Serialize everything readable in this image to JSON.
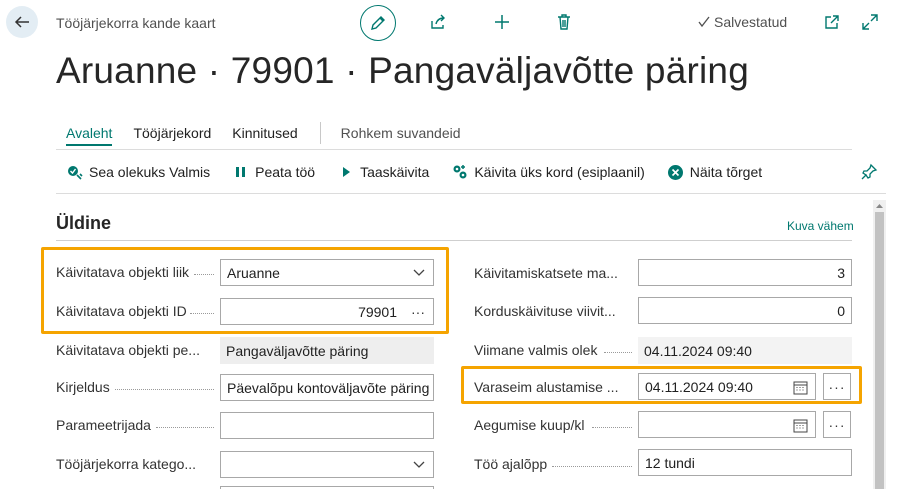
{
  "header": {
    "page_caption": "Tööjärjekorra kande kaart",
    "saved_status": "Salvestatud",
    "title": "Aruanne · 79901 · Pangaväljavõtte päring"
  },
  "tabs": [
    {
      "label": "Avaleht",
      "active": true
    },
    {
      "label": "Tööjärjekord",
      "active": false
    },
    {
      "label": "Kinnitused",
      "active": false
    }
  ],
  "more_options": "Rohkem suvandeid",
  "actions": [
    {
      "label": "Sea olekuks Valmis",
      "icon": "set-ready-icon"
    },
    {
      "label": "Peata töö",
      "icon": "pause-icon"
    },
    {
      "label": "Taaskäivita",
      "icon": "play-icon"
    },
    {
      "label": "Käivita üks kord (esiplaanil)",
      "icon": "run-once-icon"
    },
    {
      "label": "Näita tõrget",
      "icon": "error-icon"
    }
  ],
  "section": {
    "title": "Üldine",
    "show_less": "Kuva vähem"
  },
  "left_fields": [
    {
      "label": "Käivitatava objekti liik",
      "value": "Aruanne"
    },
    {
      "label": "Käivitatava objekti ID",
      "value": "79901"
    },
    {
      "label": "Käivitatava objekti pe...",
      "value": "Pangaväljavõtte päring"
    },
    {
      "label": "Kirjeldus",
      "value": "Päevalõpu kontoväljavõte päring"
    },
    {
      "label": "Parameetrijada",
      "value": ""
    },
    {
      "label": "Tööjärjekorra katego...",
      "value": ""
    }
  ],
  "right_fields": [
    {
      "label": "Käivitamiskatsete ma...",
      "value": "3"
    },
    {
      "label": "Korduskäivituse viivit...",
      "value": "0"
    },
    {
      "label": "Viimane valmis olek",
      "value": "04.11.2024 09:40"
    },
    {
      "label": "Varaseim alustamise ...",
      "value": "04.11.2024 09:40"
    },
    {
      "label": "Aegumise kuup/kl",
      "value": ""
    },
    {
      "label": "Töö ajalõpp",
      "value": "12 tundi"
    }
  ],
  "colors": {
    "accent": "#00786f",
    "highlight": "#f5a400"
  }
}
